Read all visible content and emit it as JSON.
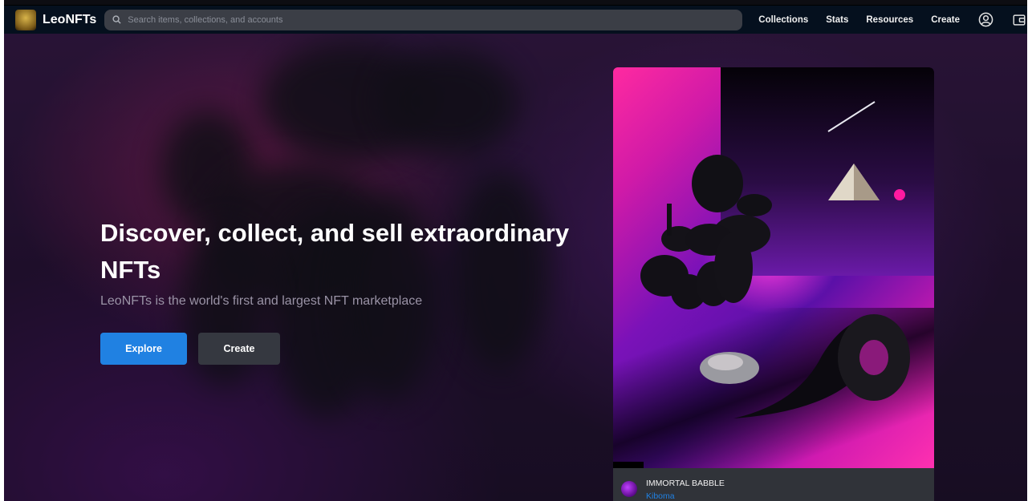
{
  "nav": {
    "brand": "LeoNFTs",
    "search_placeholder": "Search items, collections, and accounts",
    "links": [
      "Collections",
      "Stats",
      "Resources",
      "Create"
    ],
    "icons": [
      "account-icon",
      "wallet-icon"
    ]
  },
  "hero": {
    "headline": "Discover, collect, and sell extraordinary NFTs",
    "subhead": "LeoNFTs is the world's first and largest NFT marketplace",
    "explore_label": "Explore",
    "create_label": "Create"
  },
  "featured": {
    "title": "IMMORTAL BABBLE",
    "creator": "Kiboma"
  },
  "colors": {
    "nav_bg": "#05101e",
    "primary": "#2081e2",
    "secondary_button": "#353840",
    "card_bg": "#303339"
  }
}
